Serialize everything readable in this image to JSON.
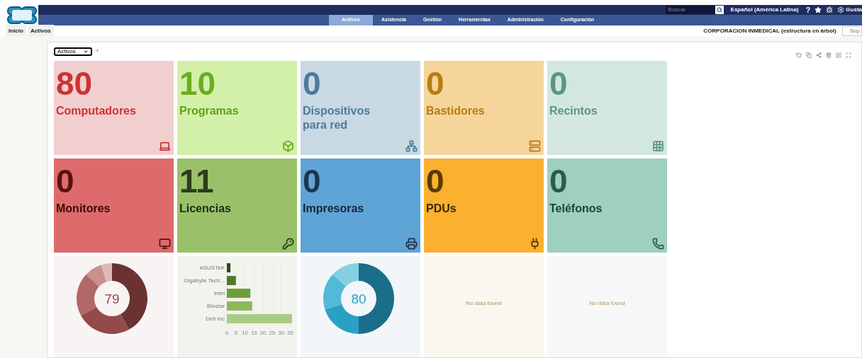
{
  "header": {
    "search": {
      "placeholder": "Buscar"
    },
    "language": "Español (América Latina)",
    "help": "?",
    "user": "Gusta"
  },
  "nav": [
    {
      "label": "Activos",
      "selected": true
    },
    {
      "label": "Asistencia",
      "selected": false
    },
    {
      "label": "Gestión",
      "selected": false
    },
    {
      "label": "Herramientas",
      "selected": false
    },
    {
      "label": "Administración",
      "selected": false
    },
    {
      "label": "Configuración",
      "selected": false
    }
  ],
  "breadcrumbs": [
    "Inicio",
    "Activos"
  ],
  "entity": "CORPORACION INMEDICAL (estructura en árbol)",
  "entity_button": "Sup",
  "dashboard": {
    "select": "Activos",
    "add": "+"
  },
  "tiles": [
    {
      "number": "80",
      "label": "Computadores",
      "color": "#f2cfcf"
    },
    {
      "number": "10",
      "label": "Programas",
      "color": "#d3f0a8"
    },
    {
      "number": "0",
      "label": "Dispositivos para red",
      "color": "#c8d9e4"
    },
    {
      "number": "0",
      "label": "Bastidores",
      "color": "#f5d59a"
    },
    {
      "number": "0",
      "label": "Recintos",
      "color": "#d4e6e2"
    },
    {
      "number": "0",
      "label": "Monitores",
      "color": "#dd6b6b"
    },
    {
      "number": "11",
      "label": "Licencias",
      "color": "#9ac16a"
    },
    {
      "number": "0",
      "label": "Impresoras",
      "color": "#5fa4d6"
    },
    {
      "number": "0",
      "label": "PDUs",
      "color": "#fbb02f"
    },
    {
      "number": "0",
      "label": "Teléfonos",
      "color": "#9ecfc0"
    }
  ],
  "widgets": [
    {
      "kind": "donut",
      "center": "79",
      "color": "#f8f4f4"
    },
    {
      "kind": "bar",
      "color": "#f1f3ee",
      "chart_data": {
        "type": "bar",
        "orientation": "horizontal",
        "categories": [
          "ASUSTeK",
          "Gigabyte Tech...",
          "Intel",
          "Biostar",
          "Dell Inc"
        ],
        "values": [
          2,
          5,
          13,
          14,
          36
        ],
        "xticks": [
          0,
          5,
          10,
          15,
          20,
          25,
          30,
          35
        ],
        "xlim": [
          0,
          36
        ],
        "grid": true
      }
    },
    {
      "kind": "donut",
      "center": "80",
      "color": "#f2f6f8"
    },
    {
      "kind": "empty",
      "message": "No data found",
      "color": "#fbf7ee"
    },
    {
      "kind": "empty",
      "message": "No data found",
      "color": "#f6f8f8"
    }
  ]
}
